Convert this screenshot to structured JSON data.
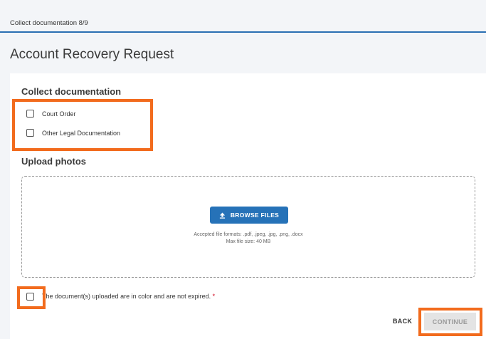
{
  "progress": {
    "label": "Collect documentation 8/9"
  },
  "page": {
    "title": "Account Recovery Request"
  },
  "collect": {
    "heading": "Collect documentation",
    "options": [
      "Court Order",
      "Other Legal Documentation"
    ]
  },
  "upload": {
    "heading": "Upload photos",
    "browse_label": "BROWSE FILES",
    "formats": "Accepted file formats: .pdf, .jpeg, .jpg, .png, .docx",
    "max_size": "Max file size: 40 MB"
  },
  "confirm": {
    "label": "The document(s) uploaded are in color and are not expired.",
    "required_mark": "*"
  },
  "actions": {
    "back_label": "BACK",
    "continue_label": "CONTINUE"
  },
  "colors": {
    "accent": "#2672b8",
    "highlight": "#f26b1d",
    "disabled_bg": "#e4e4e4",
    "required": "#d0021b"
  }
}
